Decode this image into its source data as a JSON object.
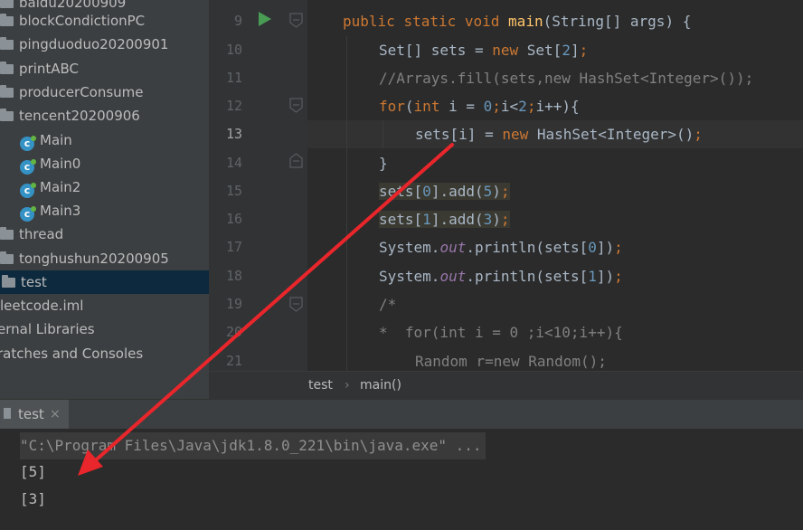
{
  "project_tree": {
    "top_partial": "baidu20200909",
    "folders_top": [
      "blockCondictionPC",
      "pingduoduo20200901",
      "printABC",
      "producerConsume",
      "tencent20200906"
    ],
    "classes": [
      "Main",
      "Main0",
      "Main2",
      "Main3"
    ],
    "folders_bottom": [
      "thread",
      "tonghushun20200905"
    ],
    "selected": "test",
    "after": [
      "leetcode.iml",
      "ernal Libraries",
      "ratches and Consoles"
    ]
  },
  "editor": {
    "line_numbers": [
      "9",
      "10",
      "11",
      "12",
      "13",
      "14",
      "15",
      "16",
      "17",
      "18",
      "19",
      "20",
      "21"
    ],
    "lines": [
      [
        "public static void main(String[] args) {"
      ],
      [
        "Set[] sets = new Set[2];"
      ],
      [
        "//Arrays.fill(sets,new HashSet<Integer>());"
      ],
      [
        "for(int i = 0;i<2;i++){"
      ],
      [
        "sets[i] = new HashSet<Integer>();"
      ],
      [
        "}"
      ],
      [
        "sets[0].add(5);"
      ],
      [
        "sets[1].add(3);"
      ],
      [
        "System.out.println(sets[0]);"
      ],
      [
        "System.out.println(sets[1]);"
      ],
      [
        "/*"
      ],
      [
        "*  for(int i = 0 ;i<10;i++){"
      ],
      [
        "Random r=new Random();"
      ]
    ]
  },
  "breadcrumb": {
    "first": "test",
    "separator": "›",
    "second": "main()"
  },
  "run": {
    "tab_label": "test",
    "close": "×",
    "command": "\"C:\\Program Files\\Java\\jdk1.8.0_221\\bin\\java.exe\" ...",
    "output": [
      "[5]",
      "[3]"
    ]
  },
  "colors": {
    "arrow": "#e8262b",
    "selection": "#0d293e",
    "run_icon": "#499c54"
  },
  "icons": [
    "folder-icon",
    "java-class-icon",
    "run-icon",
    "fold-marker-icon",
    "close-icon"
  ]
}
